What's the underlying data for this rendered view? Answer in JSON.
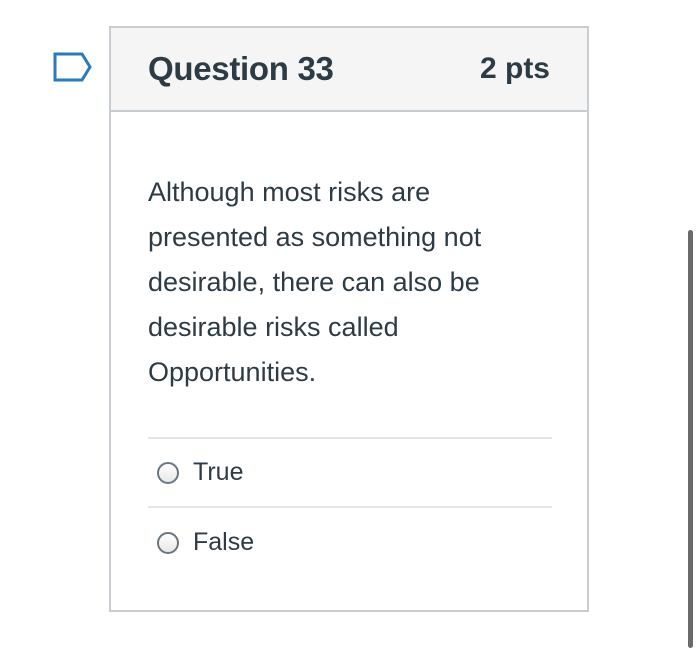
{
  "question": {
    "title": "Question 33",
    "points": "2 pts",
    "text": "Although most risks are presented as something not desirable, there can also be desirable risks called Opportunities.",
    "answers": [
      {
        "label": "True",
        "selected": false
      },
      {
        "label": "False",
        "selected": false
      }
    ]
  },
  "icons": {
    "flag": "bookmark-flag-icon"
  },
  "colors": {
    "text": "#2d3b45",
    "border": "#c7cdd1",
    "header_bg": "#f5f5f5",
    "flag": "#2b7abc"
  }
}
